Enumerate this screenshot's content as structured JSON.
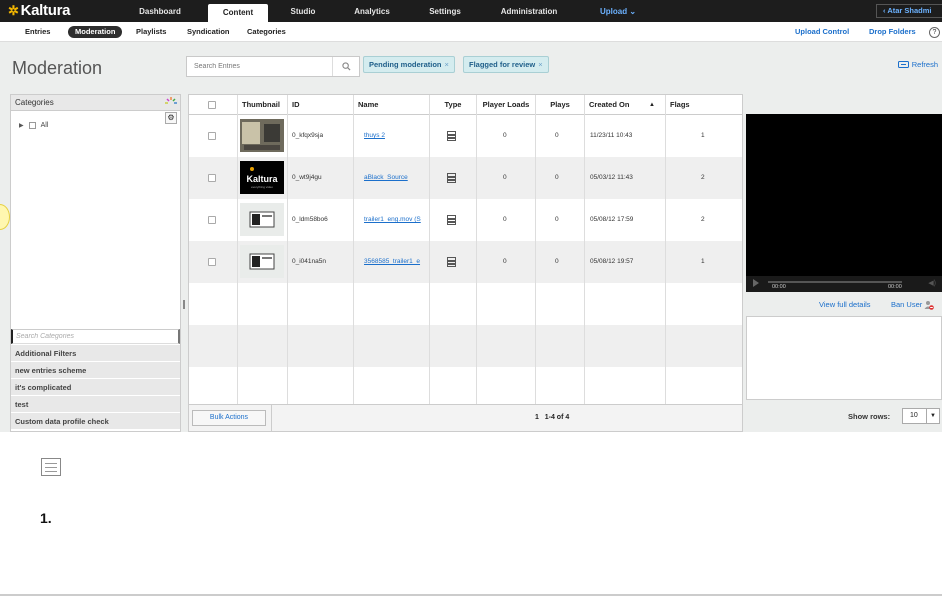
{
  "brand": {
    "name": "Kaltura"
  },
  "topnav": {
    "items": [
      "Dashboard",
      "Content",
      "Studio",
      "Analytics",
      "Settings",
      "Administration"
    ],
    "upload": "Upload",
    "user": "Atar Shadmi"
  },
  "subnav": {
    "items": [
      "Entries",
      "Moderation",
      "Playlists",
      "Syndication",
      "Categories"
    ],
    "upload_control": "Upload Control",
    "drop_folders": "Drop Folders",
    "help": "?"
  },
  "page": {
    "title": "Moderation",
    "refresh": "Refresh"
  },
  "search": {
    "placeholder": "Search Entries"
  },
  "filters": {
    "pending": "Pending moderation",
    "flagged": "Flagged for review",
    "remove": "×"
  },
  "categories": {
    "header": "Categories",
    "root": "All",
    "search_placeholder": "Search Categories",
    "sections": [
      "Additional Filters",
      "new entries scheme",
      "it's complicated",
      "test",
      "Custom data profile check"
    ]
  },
  "table": {
    "headers": {
      "thumbnail": "Thumbnail",
      "id": "ID",
      "name": "Name",
      "type": "Type",
      "player_loads": "Player Loads",
      "plays": "Plays",
      "created_on": "Created On",
      "flags": "Flags"
    },
    "rows": [
      {
        "id": "0_kfqx9sja",
        "name": "thuys 2",
        "player_loads": "0",
        "plays": "0",
        "created_on": "11/23/11 10:43",
        "flags": "1"
      },
      {
        "id": "0_wt9j4gu",
        "name": "aBlack_Source",
        "player_loads": "0",
        "plays": "0",
        "created_on": "05/03/12 11:43",
        "flags": "2"
      },
      {
        "id": "0_ldm58bo6",
        "name": "trailer1_eng.mov (S",
        "player_loads": "0",
        "plays": "0",
        "created_on": "05/08/12 17:59",
        "flags": "2"
      },
      {
        "id": "0_i041na5n",
        "name": "3568585_trailer1_e",
        "player_loads": "0",
        "plays": "0",
        "created_on": "05/08/12 19:57",
        "flags": "1"
      }
    ],
    "bulk_actions": "Bulk Actions",
    "page": "1",
    "range": "1-4 of 4",
    "show_rows_label": "Show rows:",
    "show_rows_value": "10"
  },
  "player": {
    "time_current": "00:00",
    "time_total": "00:00"
  },
  "details": {
    "view_full": "View full details",
    "ban_user": "Ban User"
  },
  "thumb_text": {
    "kaltura": "Kaltura",
    "tagline": "everything video"
  },
  "doc": {
    "step": "1."
  }
}
